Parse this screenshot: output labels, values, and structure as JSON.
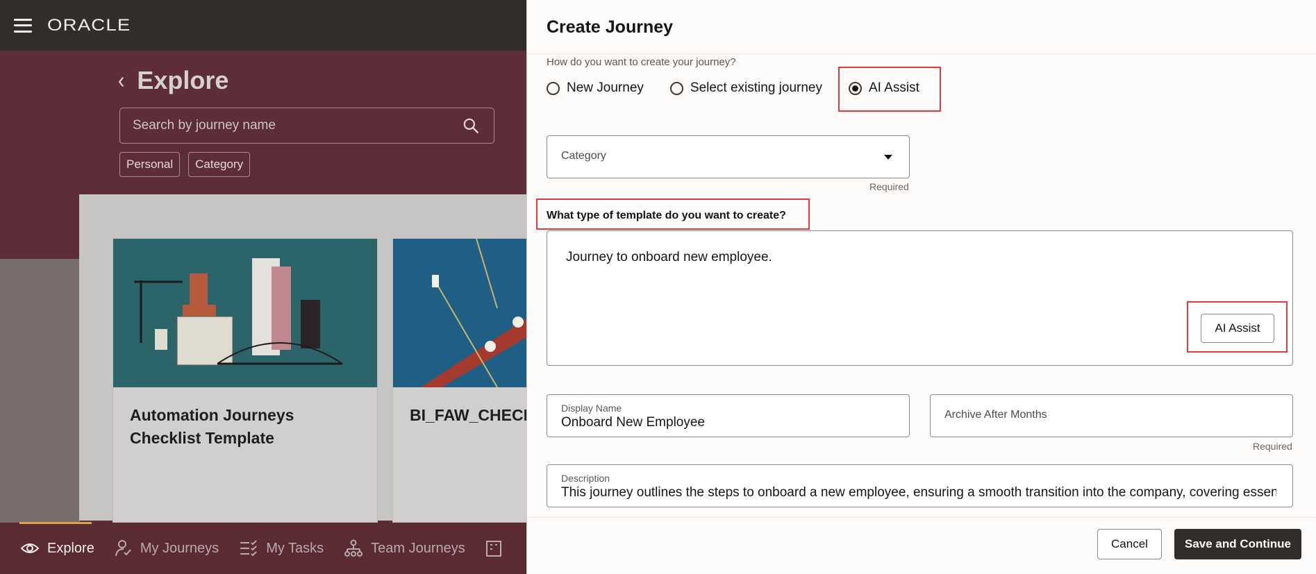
{
  "app": {
    "logo": "ORACLE",
    "explore": {
      "title": "Explore",
      "search_placeholder": "Search by journey name",
      "chips": [
        "Personal",
        "Category"
      ]
    },
    "cards": [
      {
        "title_line1": "Automation Journeys",
        "title_line2": "Checklist Template"
      },
      {
        "title_line1": "BI_FAW_CHECK",
        "title_line2": ""
      }
    ],
    "bottom_nav": {
      "explore": "Explore",
      "my_journeys": "My Journeys",
      "my_tasks": "My Tasks",
      "team_journeys": "Team Journeys"
    }
  },
  "drawer": {
    "title": "Create Journey",
    "question": "How do you want to create your journey?",
    "options": {
      "new": "New Journey",
      "existing": "Select existing journey",
      "ai": "AI Assist"
    },
    "selected_option": "AI Assist",
    "category": {
      "placeholder": "Category",
      "required": "Required"
    },
    "template_label": "What type of template do you want to create?",
    "template_text": "Journey to onboard new employee.",
    "ai_assist_button": "AI Assist",
    "display_name": {
      "label": "Display Name",
      "value": "Onboard New Employee"
    },
    "archive": {
      "placeholder": "Archive After Months",
      "required": "Required"
    },
    "description": {
      "label": "Description",
      "value": "This journey outlines the steps to onboard a new employee, ensuring a smooth transition into the company, covering essential"
    },
    "cancel": "Cancel",
    "save": "Save and Continue"
  },
  "colors": {
    "highlight": "#e0393e",
    "primary_button": "#312d2a",
    "hero_background": "#5e2e38"
  }
}
